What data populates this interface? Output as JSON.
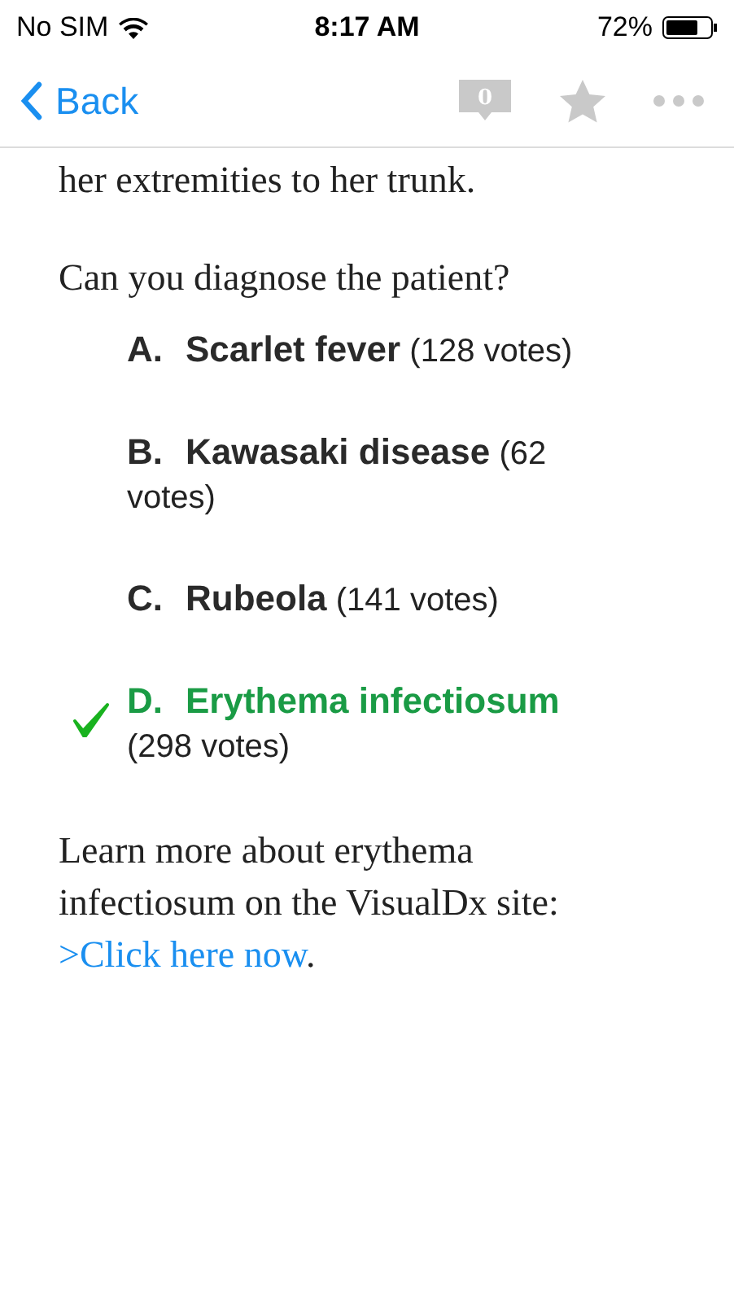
{
  "status_bar": {
    "carrier": "No SIM",
    "time": "8:17 AM",
    "battery": "72%"
  },
  "nav_bar": {
    "back": "Back",
    "comment_count": "0"
  },
  "intro": "her extremities to her trunk.",
  "question": "Can you diagnose the patient?",
  "answers": [
    {
      "letter": "A.",
      "name": "Scarlet fever",
      "votes": "(128 votes)",
      "correct": false
    },
    {
      "letter": "B.",
      "name": "Kawasaki disease",
      "votes": "(62 votes)",
      "correct": false
    },
    {
      "letter": "C.",
      "name": "Rubeola",
      "votes": "(141 votes)",
      "correct": false
    },
    {
      "letter": "D.",
      "name": "Erythema infectiosum",
      "votes": "(298 votes)",
      "correct": true
    }
  ],
  "learn_more": {
    "text": "Learn more about erythema infectiosum on the VisualDx site:",
    "link": ">Click here now",
    "after": "."
  }
}
